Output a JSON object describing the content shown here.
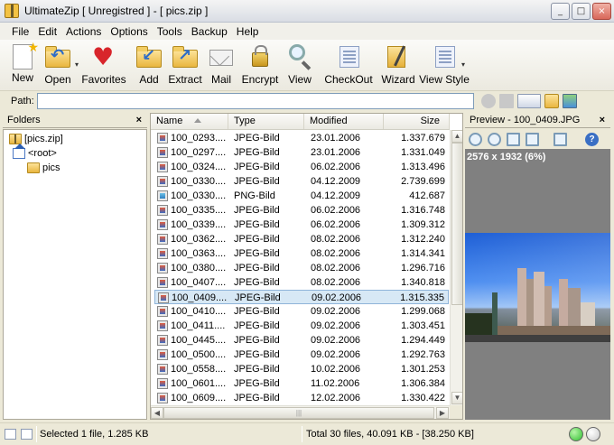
{
  "window": {
    "title": "UltimateZip [ Unregistred ] - [ pics.zip ]",
    "buttons": {
      "minimize": "_",
      "maximize": "□",
      "close": "×"
    }
  },
  "menu": [
    "File",
    "Edit",
    "Actions",
    "Options",
    "Tools",
    "Backup",
    "Help"
  ],
  "toolbar": [
    {
      "label": "New",
      "icon": "new-archive-icon"
    },
    {
      "label": "Open",
      "icon": "open-folder-icon"
    },
    {
      "label": "Favorites",
      "icon": "heart-icon"
    },
    {
      "label": "Add",
      "icon": "add-files-icon"
    },
    {
      "label": "Extract",
      "icon": "extract-icon"
    },
    {
      "label": "Mail",
      "icon": "mail-icon"
    },
    {
      "label": "Encrypt",
      "icon": "lock-icon"
    },
    {
      "label": "View",
      "icon": "magnifier-icon"
    },
    {
      "label": "CheckOut",
      "icon": "checkout-icon"
    },
    {
      "label": "Wizard",
      "icon": "wizard-icon"
    },
    {
      "label": "View Style",
      "icon": "view-style-icon"
    }
  ],
  "path": {
    "label": "Path:",
    "value": ""
  },
  "folders": {
    "title": "Folders",
    "close": "×",
    "tree": [
      {
        "label": "[pics.zip]",
        "icon": "zip-icon"
      },
      {
        "label": "<root>",
        "icon": "home-icon"
      },
      {
        "label": "pics",
        "icon": "folder-icon"
      }
    ]
  },
  "files": {
    "columns": [
      "Name",
      "Type",
      "Modified",
      "Size"
    ],
    "rows": [
      {
        "name": "100_0293....",
        "type": "JPEG-Bild",
        "modified": "23.01.2006",
        "size": "1.337.679",
        "icon": "jpeg-file-icon"
      },
      {
        "name": "100_0297....",
        "type": "JPEG-Bild",
        "modified": "23.01.2006",
        "size": "1.331.049",
        "icon": "jpeg-file-icon"
      },
      {
        "name": "100_0324....",
        "type": "JPEG-Bild",
        "modified": "06.02.2006",
        "size": "1.313.496",
        "icon": "jpeg-file-icon"
      },
      {
        "name": "100_0330....",
        "type": "JPEG-Bild",
        "modified": "04.12.2009",
        "size": "2.739.699",
        "icon": "jpeg-file-icon"
      },
      {
        "name": "100_0330....",
        "type": "PNG-Bild",
        "modified": "04.12.2009",
        "size": "412.687",
        "icon": "png-file-icon"
      },
      {
        "name": "100_0335....",
        "type": "JPEG-Bild",
        "modified": "06.02.2006",
        "size": "1.316.748",
        "icon": "jpeg-file-icon"
      },
      {
        "name": "100_0339....",
        "type": "JPEG-Bild",
        "modified": "06.02.2006",
        "size": "1.309.312",
        "icon": "jpeg-file-icon"
      },
      {
        "name": "100_0362....",
        "type": "JPEG-Bild",
        "modified": "08.02.2006",
        "size": "1.312.240",
        "icon": "jpeg-file-icon"
      },
      {
        "name": "100_0363....",
        "type": "JPEG-Bild",
        "modified": "08.02.2006",
        "size": "1.314.341",
        "icon": "jpeg-file-icon"
      },
      {
        "name": "100_0380....",
        "type": "JPEG-Bild",
        "modified": "08.02.2006",
        "size": "1.296.716",
        "icon": "jpeg-file-icon"
      },
      {
        "name": "100_0407....",
        "type": "JPEG-Bild",
        "modified": "08.02.2006",
        "size": "1.340.818",
        "icon": "jpeg-file-icon"
      },
      {
        "name": "100_0409....",
        "type": "JPEG-Bild",
        "modified": "09.02.2006",
        "size": "1.315.335",
        "icon": "jpeg-file-icon",
        "selected": true
      },
      {
        "name": "100_0410....",
        "type": "JPEG-Bild",
        "modified": "09.02.2006",
        "size": "1.299.068",
        "icon": "jpeg-file-icon"
      },
      {
        "name": "100_0411....",
        "type": "JPEG-Bild",
        "modified": "09.02.2006",
        "size": "1.303.451",
        "icon": "jpeg-file-icon"
      },
      {
        "name": "100_0445....",
        "type": "JPEG-Bild",
        "modified": "09.02.2006",
        "size": "1.294.449",
        "icon": "jpeg-file-icon"
      },
      {
        "name": "100_0500....",
        "type": "JPEG-Bild",
        "modified": "09.02.2006",
        "size": "1.292.763",
        "icon": "jpeg-file-icon"
      },
      {
        "name": "100_0558....",
        "type": "JPEG-Bild",
        "modified": "10.02.2006",
        "size": "1.301.253",
        "icon": "jpeg-file-icon"
      },
      {
        "name": "100_0601....",
        "type": "JPEG-Bild",
        "modified": "11.02.2006",
        "size": "1.306.384",
        "icon": "jpeg-file-icon"
      },
      {
        "name": "100_0609....",
        "type": "JPEG-Bild",
        "modified": "12.02.2006",
        "size": "1.330.422",
        "icon": "jpeg-file-icon"
      }
    ]
  },
  "preview": {
    "title": "Preview - 100_0409.JPG",
    "close": "×",
    "info": "2576 x 1932 (6%)",
    "tools": [
      "zoom-in-icon",
      "zoom-out-icon",
      "fit-icon",
      "actual-size-icon",
      "print-icon",
      "help-icon"
    ],
    "help_label": "?"
  },
  "status": {
    "left": "Selected 1 file, 1.285 KB",
    "right": "Total 30 files, 40.091 KB - [38.250 KB]",
    "led_colors": [
      "#2fbf2f",
      "#c9c9c9"
    ]
  }
}
